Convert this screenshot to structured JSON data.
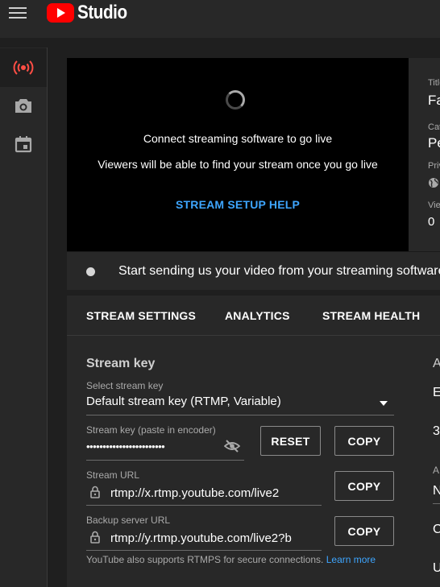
{
  "app": {
    "brand": "Studio"
  },
  "sidebar": {
    "items": [
      {
        "name": "stream"
      },
      {
        "name": "webcam"
      },
      {
        "name": "manage"
      }
    ]
  },
  "preview": {
    "line1": "Connect streaming software to go live",
    "line2": "Viewers will be able to find your stream once you go live",
    "help_link": "STREAM SETUP HELP"
  },
  "info": {
    "title_label": "Title",
    "title_value": "Fa",
    "category_label": "Category",
    "category_value": "Pe",
    "privacy_label": "Privacy",
    "viewers_label": "Viewers",
    "viewers_value": "0"
  },
  "status": {
    "message": "Start sending us your video from your streaming software"
  },
  "tabs": [
    {
      "label": "STREAM SETTINGS"
    },
    {
      "label": "ANALYTICS"
    },
    {
      "label": "STREAM HEALTH"
    }
  ],
  "stream": {
    "section_title": "Stream key",
    "select_label": "Select stream key",
    "select_value": "Default stream key (RTMP, Variable)",
    "key_label": "Stream key (paste in encoder)",
    "key_value": "••••••••••••••••••••••••",
    "reset_label": "RESET",
    "copy_label": "COPY",
    "url_label": "Stream URL",
    "url_value": "rtmp://x.rtmp.youtube.com/live2",
    "backup_label": "Backup server URL",
    "backup_value": "rtmp://y.rtmp.youtube.com/live2?b",
    "footnote": "YouTube also supports RTMPS for secure connections.",
    "learn_more": "Learn more"
  },
  "right_col": {
    "a": "A",
    "e": "E",
    "three": "3",
    "n": "N",
    "c": "C",
    "u": "U"
  },
  "colors": {
    "accent": "#3ea6ff",
    "brand_red": "#ff0000",
    "live_red": "#ff4e45"
  }
}
